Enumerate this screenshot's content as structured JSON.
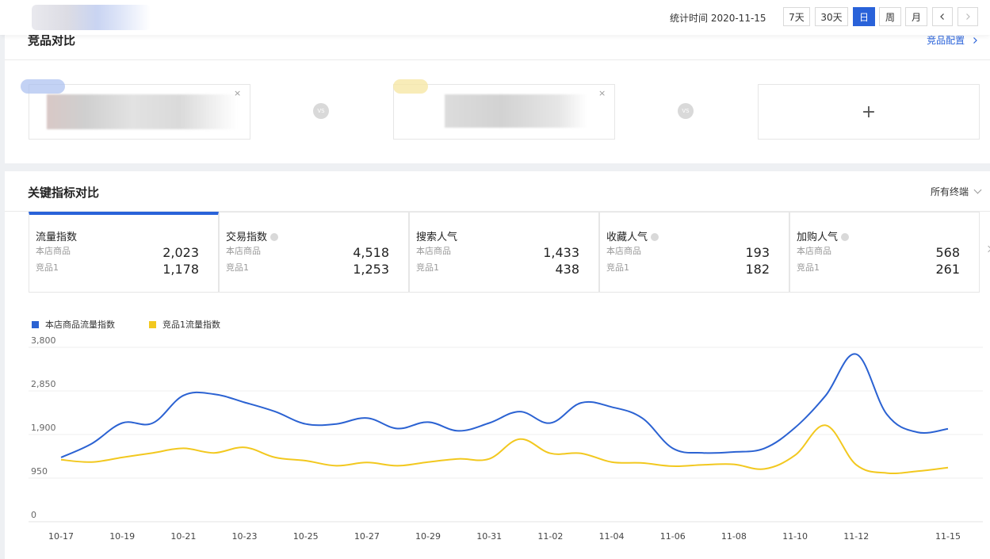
{
  "topbar": {
    "stat_time": "统计时间 2020-11-15",
    "ranges": [
      "7天",
      "30天",
      "日",
      "周",
      "月"
    ],
    "active_range": "日",
    "prev_icon": "chevron-left-icon",
    "next_icon": "chevron-right-icon"
  },
  "compare_panel": {
    "title": "竞品对比",
    "config_link": "竞品配置",
    "vs_label": "VS",
    "add_label": "+"
  },
  "metrics_panel": {
    "title": "关键指标对比",
    "terminal": "所有终端",
    "metrics": [
      {
        "title": "流量指数",
        "label_a": "本店商品",
        "value_a": "2,023",
        "label_b": "竞品1",
        "value_b": "1,178"
      },
      {
        "title": "交易指数",
        "label_a": "本店商品",
        "value_a": "4,518",
        "label_b": "竞品1",
        "value_b": "1,253"
      },
      {
        "title": "搜索人气",
        "label_a": "本店商品",
        "value_a": "1,433",
        "label_b": "竞品1",
        "value_b": "438"
      },
      {
        "title": "收藏人气",
        "label_a": "本店商品",
        "value_a": "193",
        "label_b": "竞品1",
        "value_b": "182"
      },
      {
        "title": "加购人气",
        "label_a": "本店商品",
        "value_a": "568",
        "label_b": "竞品1",
        "value_b": "261"
      }
    ]
  },
  "chart_data": {
    "type": "line",
    "title": "",
    "xlabel": "",
    "ylabel": "",
    "ylim": [
      0,
      3800
    ],
    "yticks": [
      "0",
      "950",
      "1,900",
      "2,850",
      "3,800"
    ],
    "xticks": [
      "10-17",
      "10-19",
      "10-21",
      "10-23",
      "10-25",
      "10-27",
      "10-29",
      "10-31",
      "11-02",
      "11-04",
      "11-06",
      "11-08",
      "11-10",
      "11-12",
      "11-15"
    ],
    "legend_position": "top-left",
    "grid": true,
    "x": [
      "10-17",
      "10-18",
      "10-19",
      "10-20",
      "10-21",
      "10-22",
      "10-23",
      "10-24",
      "10-25",
      "10-26",
      "10-27",
      "10-28",
      "10-29",
      "10-30",
      "10-31",
      "11-01",
      "11-02",
      "11-03",
      "11-04",
      "11-05",
      "11-06",
      "11-07",
      "11-08",
      "11-09",
      "11-10",
      "11-11",
      "11-12",
      "11-13",
      "11-14",
      "11-15"
    ],
    "series": [
      {
        "name": "本店商品流量指数",
        "color": "#2b62d2",
        "values": [
          1400,
          1700,
          2150,
          2150,
          2750,
          2780,
          2600,
          2400,
          2130,
          2130,
          2260,
          2030,
          2170,
          1980,
          2150,
          2400,
          2150,
          2590,
          2500,
          2260,
          1600,
          1500,
          1520,
          1600,
          2050,
          2750,
          3650,
          2340,
          1950,
          2023
        ]
      },
      {
        "name": "竞品1流量指数",
        "color": "#f2c81f",
        "values": [
          1350,
          1300,
          1400,
          1500,
          1600,
          1500,
          1620,
          1400,
          1330,
          1220,
          1290,
          1220,
          1300,
          1370,
          1370,
          1800,
          1490,
          1490,
          1300,
          1280,
          1210,
          1240,
          1250,
          1150,
          1450,
          2100,
          1240,
          1060,
          1100,
          1178
        ]
      }
    ]
  }
}
